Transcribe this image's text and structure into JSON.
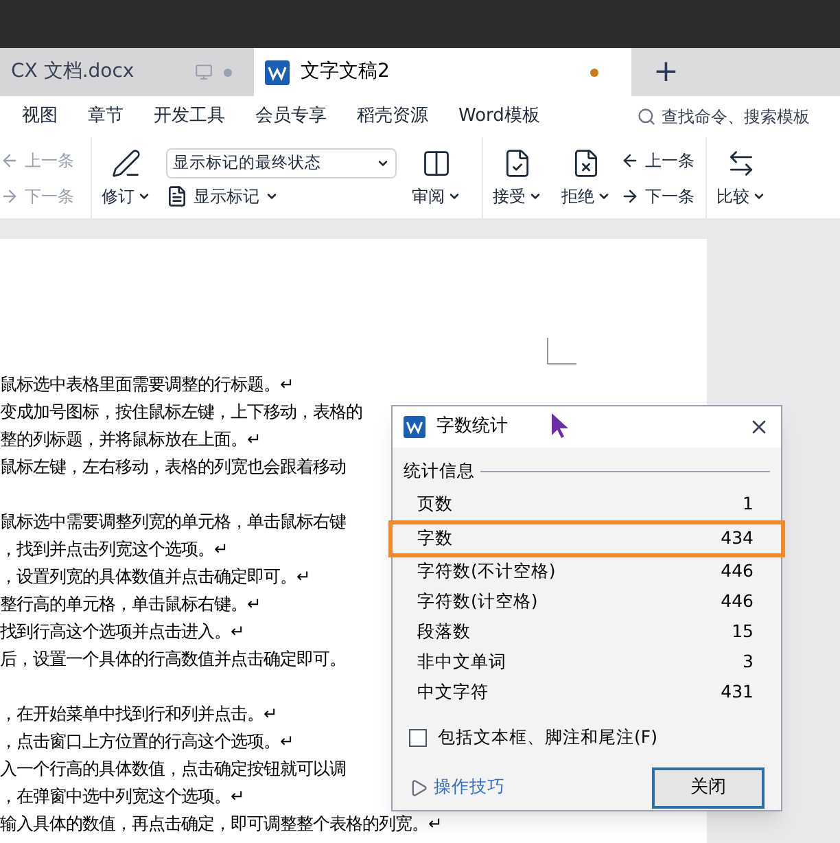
{
  "tabs": [
    {
      "label": "CX 文档.docx",
      "selected": false
    },
    {
      "label": "文字文稿2",
      "selected": true,
      "unsaved": true
    }
  ],
  "new_tab": "+",
  "menu": [
    "视图",
    "章节",
    "开发工具",
    "会员专享",
    "稻壳资源",
    "Word模板"
  ],
  "search": {
    "placeholder": "查找命令、搜索模板"
  },
  "toolbar": {
    "nav_left": [
      {
        "label": "上一条",
        "disabled": true
      },
      {
        "label": "下一条",
        "disabled": true
      }
    ],
    "revise": "修订",
    "markup_select": {
      "value": "显示标记的最终状态"
    },
    "show_markup": "显示标记",
    "review": "审阅",
    "accept": "接受",
    "reject": "拒绝",
    "nav_right": [
      {
        "label": "上一条",
        "disabled": false
      },
      {
        "label": "下一条",
        "disabled": false
      }
    ],
    "compare": "比较"
  },
  "document": {
    "blocks": [
      [
        "鼠标选中表格里面需要调整的行标题。↵",
        "变成加号图标，按住鼠标左键，上下移动，表格的",
        "整的列标题，并将鼠标放在上面。↵",
        "鼠标左键，左右移动，表格的列宽也会跟着移动"
      ],
      [
        "鼠标选中需要调整列宽的单元格，单击鼠标右键",
        "，找到并点击列宽这个选项。↵",
        "，设置列宽的具体数值并点击确定即可。↵",
        "整行高的单元格，单击鼠标右键。↵",
        "找到行高这个选项并点击进入。↵",
        "后，设置一个具体的行高数值并点击确定即可。"
      ],
      [
        "，在开始菜单中找到行和列并点击。↵",
        "，点击窗口上方位置的行高这个选项。↵",
        "入一个行高的具体数值，点击确定按钮就可以调",
        "，在弹窗中选中列宽这个选项。↵",
        "输入具体的数值，再点击确定，即可调整整个表格的列宽。↵"
      ]
    ]
  },
  "dialog": {
    "title": "字数统计",
    "section": "统计信息",
    "rows": [
      {
        "label": "页数",
        "value": "1",
        "highlighted": false
      },
      {
        "label": "字数",
        "value": "434",
        "highlighted": true
      },
      {
        "label": "字符数(不计空格)",
        "value": "446",
        "highlighted": false
      },
      {
        "label": "字符数(计空格)",
        "value": "446",
        "highlighted": false
      },
      {
        "label": "段落数",
        "value": "15",
        "highlighted": false
      },
      {
        "label": "非中文单词",
        "value": "3",
        "highlighted": false
      },
      {
        "label": "中文字符",
        "value": "431",
        "highlighted": false
      }
    ],
    "checkbox": {
      "label": "包括文本框、脚注和尾注(F)",
      "checked": false
    },
    "tips_link": "操作技巧",
    "close_button": "关闭"
  }
}
